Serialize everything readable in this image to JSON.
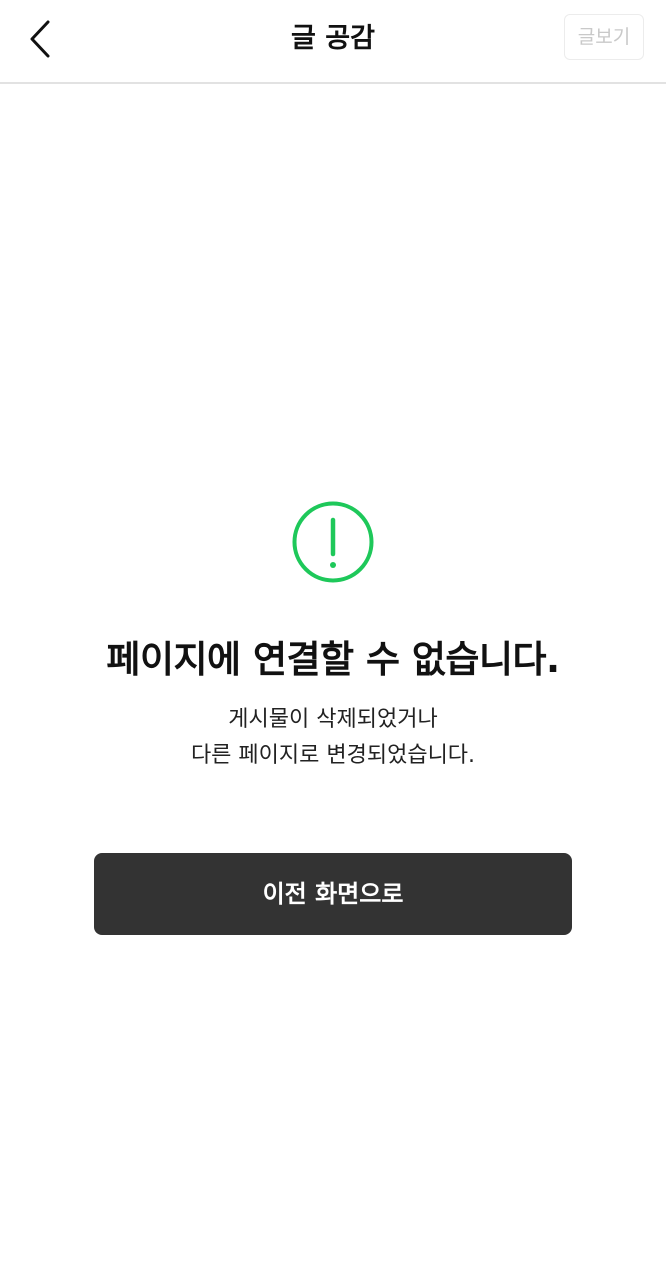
{
  "header": {
    "title": "글 공감",
    "view_post_label": "글보기"
  },
  "error": {
    "title": "페이지에 연결할 수 없습니다.",
    "description_line1": "게시물이 삭제되었거나",
    "description_line2": "다른 페이지로 변경되었습니다."
  },
  "actions": {
    "prev_screen_label": "이전 화면으로"
  },
  "icons": {
    "back": "chevron-left-icon",
    "warning": "exclamation-circle-icon"
  },
  "colors": {
    "accent": "#1ec85a",
    "button_bg": "#333333",
    "disabled_text": "#c9c9c9"
  }
}
